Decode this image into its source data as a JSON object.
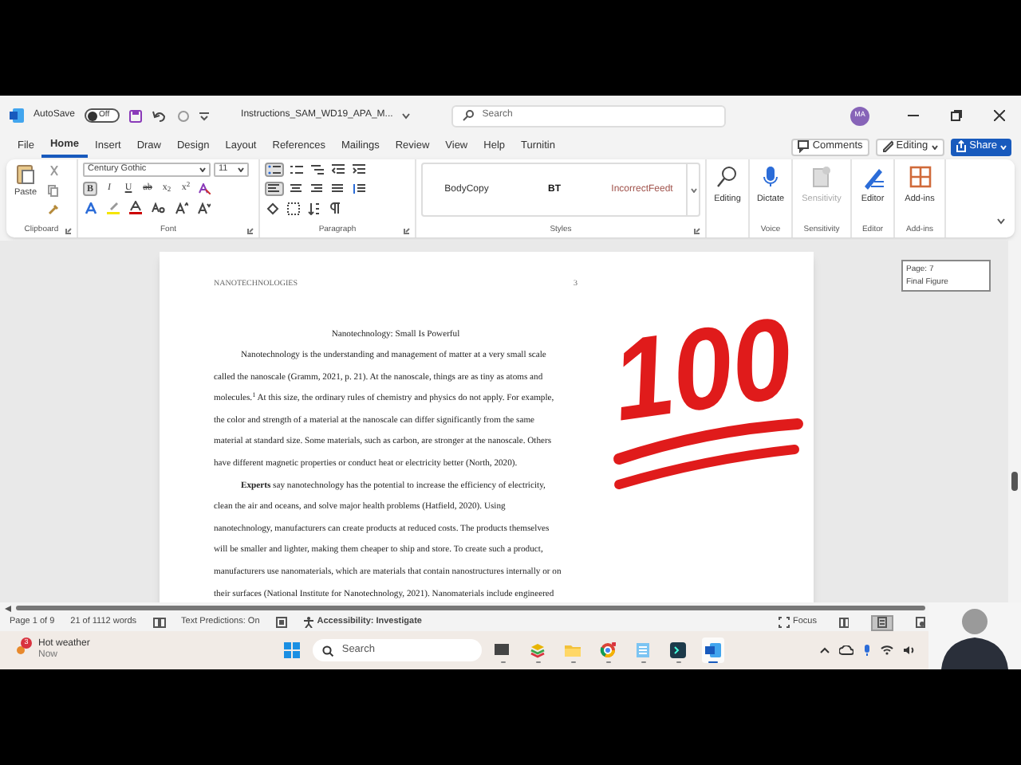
{
  "title_bar": {
    "autosave": "AutoSave",
    "autosave_toggle": {
      "label": "Off",
      "on": false
    },
    "document_title": "Instructions_SAM_WD19_APA_M...",
    "search_placeholder": "Search",
    "avatar": "MA"
  },
  "menu_tabs": [
    {
      "label": "File",
      "selected": false
    },
    {
      "label": "Home",
      "selected": true
    },
    {
      "label": "Insert",
      "selected": false
    },
    {
      "label": "Draw",
      "selected": false
    },
    {
      "label": "Design",
      "selected": false
    },
    {
      "label": "Layout",
      "selected": false
    },
    {
      "label": "References",
      "selected": false
    },
    {
      "label": "Mailings",
      "selected": false
    },
    {
      "label": "Review",
      "selected": false
    },
    {
      "label": "View",
      "selected": false
    },
    {
      "label": "Help",
      "selected": false
    },
    {
      "label": "Turnitin",
      "selected": false
    }
  ],
  "header_buttons": [
    {
      "kind": "comments",
      "label": "Comments"
    },
    {
      "kind": "editing",
      "label": "Editing"
    },
    {
      "kind": "share",
      "label": "Share"
    }
  ],
  "ribbon": {
    "clipboard": {
      "paste": "Paste",
      "label": "Clipboard"
    },
    "font": {
      "name": "Century Gothic",
      "size": "11",
      "label": "Font",
      "formats": [
        {
          "label": "B",
          "selected": true
        },
        {
          "label": "I",
          "selected": false
        },
        {
          "label": "U",
          "selected": false
        },
        {
          "label": "ab",
          "selected": false
        },
        {
          "label": "x$_{2}$",
          "selected": false
        },
        {
          "label": "x$^{2}$",
          "selected": false
        }
      ]
    },
    "paragraph": {
      "label": "Paragraph",
      "bullets_selected": true,
      "align_left_selected": true
    },
    "styles": {
      "label": "Styles",
      "items": [
        {
          "label": "BodyCopy",
          "color": "#333333"
        },
        {
          "label": "BT",
          "color": "#111111"
        },
        {
          "label": "IncorrectFeedt",
          "color": "#a0524b"
        }
      ]
    },
    "tools": [
      {
        "kind": "editing",
        "label": "Editing",
        "disabled": false
      },
      {
        "kind": "dictate",
        "label": "Dictate",
        "group": "Voice",
        "disabled": false
      },
      {
        "kind": "sensitivity",
        "label": "Sensitivity",
        "group": "Sensitivity",
        "disabled": true
      },
      {
        "kind": "editor",
        "label": "Editor",
        "group": "Editor",
        "disabled": false
      },
      {
        "kind": "addins",
        "label": "Add-ins",
        "group": "Add-ins",
        "disabled": false
      }
    ]
  },
  "document": {
    "header": "NANOTECHNOLOGIES",
    "page_number": "3",
    "title": "Nanotechnology: Small Is Powerful",
    "paragraphs": [
      {
        "lines": [
          "Nanotechnology is the understanding and management of matter at a very small scale",
          "called the nanoscale (Gramm, 2021, p. 21). At the nanoscale, things are as tiny as atoms and",
          "molecules.$^{1}$ At this size, the ordinary rules of chemistry and physics do not apply. For example,",
          "the color and strength of a material at the nanoscale can differ significantly from the same",
          "material at standard size. Some materials, such as carbon, are stronger at the nanoscale. Others",
          "have different magnetic properties or conduct heat or electricity better (North, 2020)."
        ]
      },
      {
        "lines": [
          "**Experts** say nanotechnology has the potential to increase the efficiency of electricity,",
          "clean the air and oceans, and solve major health problems (Hatfield, 2020). Using",
          "nanotechnology, manufacturers can create products at reduced costs. The products themselves",
          "will be smaller and lighter, making them cheaper to ship and store. To create such a product,",
          "manufacturers use nanomaterials, which are materials that contain nanostructures internally or on",
          "their surfaces (National Institute for Nanotechnology, 2021). Nanomaterials include engineered"
        ]
      }
    ]
  },
  "sticker": "100",
  "tooltip": [
    "Page: 7",
    "Final Figure"
  ],
  "status_bar": {
    "page": "Page 1 of 9",
    "words": "21 of 1112 words",
    "predictions": "Text Predictions: On",
    "accessibility": "Accessibility: Investigate",
    "focus": "Focus",
    "views": [
      {
        "kind": "read",
        "selected": false
      },
      {
        "kind": "print",
        "selected": true
      },
      {
        "kind": "web",
        "selected": false
      }
    ]
  },
  "taskbar": {
    "weather": {
      "badge": "3",
      "title": "Hot weather",
      "subtitle": "Now"
    },
    "search_placeholder": "Search",
    "apps": [
      {
        "kind": "slides",
        "selected": false
      },
      {
        "kind": "stack",
        "selected": false
      },
      {
        "kind": "folder",
        "selected": false
      },
      {
        "kind": "browser",
        "selected": false
      },
      {
        "kind": "notepad",
        "selected": false
      },
      {
        "kind": "terminal",
        "selected": false
      },
      {
        "kind": "word",
        "selected": true
      }
    ]
  }
}
